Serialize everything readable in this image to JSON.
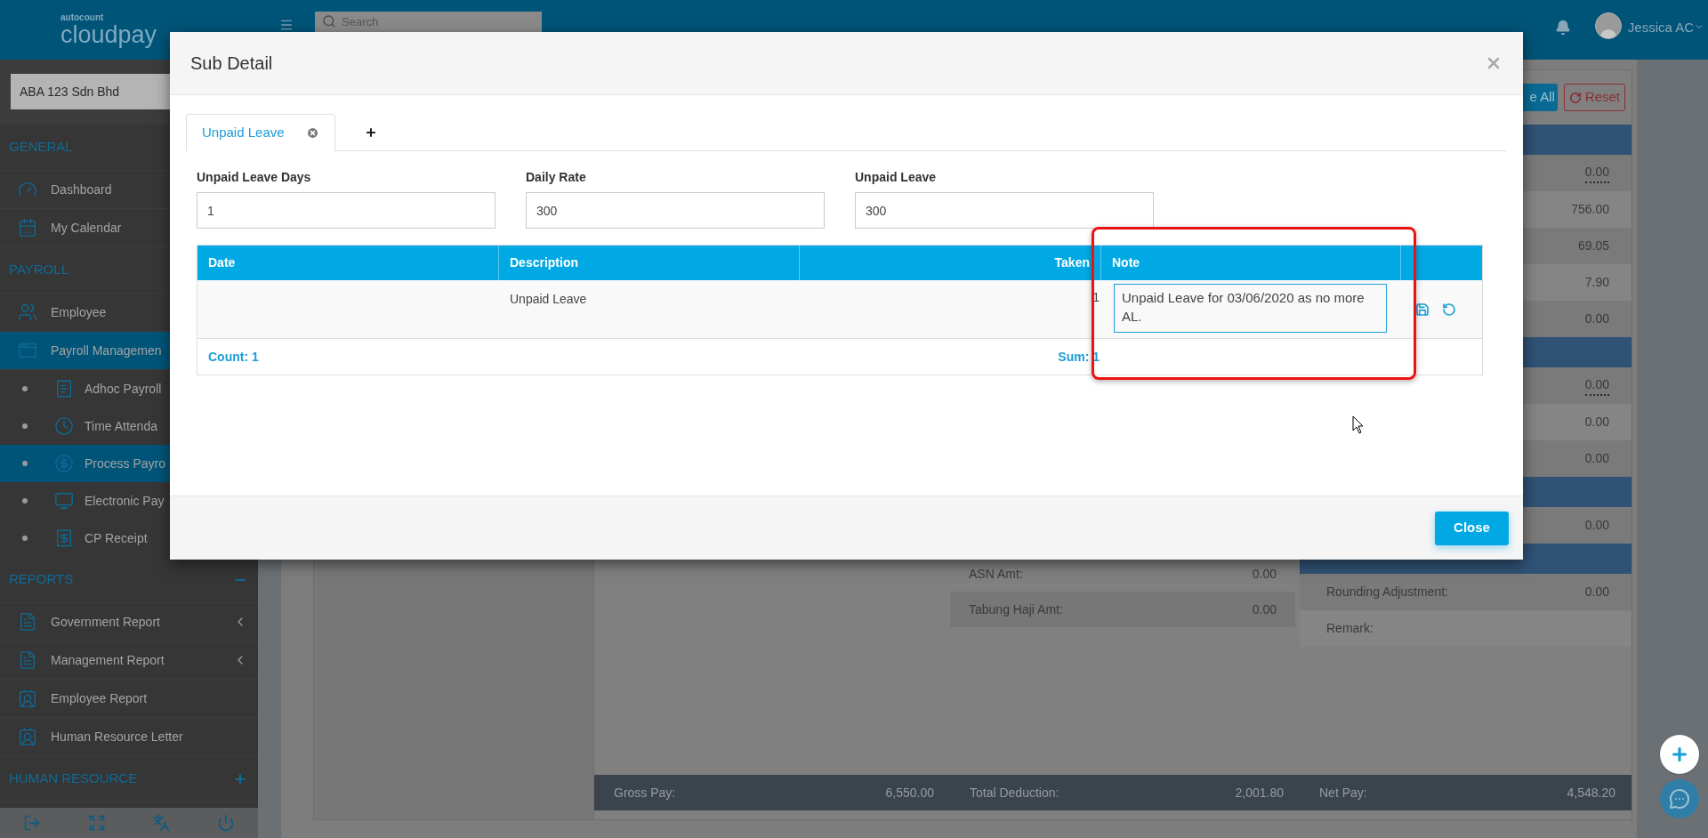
{
  "header": {
    "logo": {
      "small": "autocount",
      "large": "cloudpay"
    },
    "search": {
      "placeholder": "Search"
    },
    "user": {
      "name": "Jessica AC"
    }
  },
  "sidebar": {
    "company": "ABA 123 Sdn Bhd",
    "sections": [
      {
        "title": "GENERAL",
        "items": [
          {
            "label": "Dashboard",
            "selected": false
          },
          {
            "label": "My Calendar",
            "selected": false
          }
        ]
      },
      {
        "title": "PAYROLL",
        "items": [
          {
            "label": "Employee",
            "selected": false
          },
          {
            "label": "Payroll Managemen",
            "selected": true,
            "children": [
              {
                "label": "Adhoc Payroll",
                "selected": false
              },
              {
                "label": "Time Attenda",
                "selected": false
              },
              {
                "label": "Process Payro",
                "selected": true
              },
              {
                "label": "Electronic Pay",
                "selected": false
              },
              {
                "label": "CP Receipt",
                "selected": false
              }
            ]
          }
        ]
      },
      {
        "title": "REPORTS",
        "expanded": true,
        "items": [
          {
            "label": "Government Report",
            "selected": false,
            "submenu": true
          },
          {
            "label": "Management Report",
            "selected": false,
            "submenu": true
          },
          {
            "label": "Employee Report",
            "selected": false,
            "submenu": false
          },
          {
            "label": "Human Resource Letter",
            "selected": false,
            "submenu": false
          }
        ]
      },
      {
        "title": "HUMAN RESOURCE",
        "expanded": false
      }
    ]
  },
  "page": {
    "toolbar": [
      {
        "label": "e All",
        "kind": "primary"
      },
      {
        "label": "Reset",
        "kind": "danger"
      }
    ],
    "summary": [
      {
        "kind": "header"
      },
      {
        "kind": "value",
        "value": "0.00",
        "underlined": true
      },
      {
        "kind": "value",
        "value": "756.00",
        "underlined": false
      },
      {
        "kind": "value",
        "value": "69.05",
        "underlined": false
      },
      {
        "kind": "value",
        "value": "7.90",
        "underlined": false
      },
      {
        "kind": "value",
        "value": "0.00",
        "underlined": false
      },
      {
        "kind": "header"
      },
      {
        "kind": "value",
        "value": "0.00",
        "underlined": true
      },
      {
        "kind": "value",
        "value": "0.00",
        "underlined": false
      },
      {
        "kind": "value",
        "value": "0.00",
        "underlined": false
      },
      {
        "kind": "header"
      },
      {
        "kind": "value",
        "value": "0.00",
        "underlined": false
      },
      {
        "kind": "header"
      },
      {
        "kind": "value",
        "label": "Rounding Adjustment:",
        "value": "0.00",
        "underlined": false
      },
      {
        "kind": "value",
        "label": "Remark:"
      }
    ],
    "deductions": [
      {
        "label": "ASN Amt:",
        "value": "0.00"
      },
      {
        "label": "Tabung Haji Amt:",
        "value": "0.00"
      }
    ],
    "totals": [
      {
        "label": "Gross Pay:",
        "value": "6,550.00"
      },
      {
        "label": "Total Deduction:",
        "value": "2,001.80"
      },
      {
        "label": "Net Pay:",
        "value": "4,548.20"
      }
    ]
  },
  "dialog": {
    "title": "Sub Detail",
    "tabs": [
      {
        "kind": "tab",
        "label": "Unpaid Leave",
        "selected": true
      },
      {
        "kind": "add",
        "selected": false
      }
    ],
    "fields": [
      {
        "label": "Unpaid Leave Days",
        "value": "1"
      },
      {
        "label": "Daily Rate",
        "value": "300"
      },
      {
        "label": "Unpaid Leave",
        "value": "300"
      }
    ],
    "table": {
      "columns": [
        "Date",
        "Description",
        "Taken",
        "Note"
      ],
      "rows": [
        {
          "description": "Unpaid Leave",
          "taken": "1",
          "note": "Unpaid Leave for 03/06/2020 as no more AL.",
          "editing": true
        }
      ],
      "footer": {
        "count": "Count: 1",
        "sum": "Sum: 1"
      }
    },
    "buttons": [
      "Close"
    ]
  }
}
